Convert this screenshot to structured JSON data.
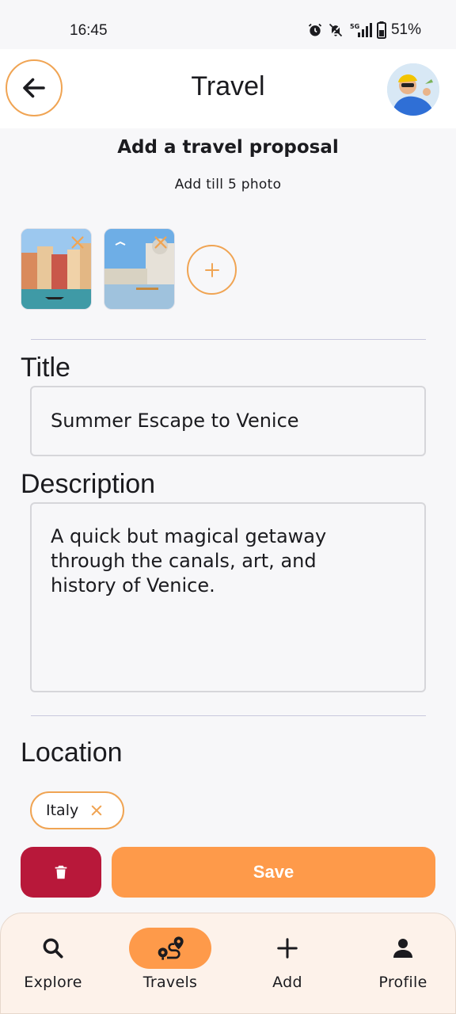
{
  "status_bar": {
    "time": "16:45",
    "battery": "51%",
    "icons": [
      "alarm-icon",
      "bell-off-icon",
      "signal-5g-icon",
      "battery-icon"
    ]
  },
  "header": {
    "title": "Travel",
    "back_icon": "arrow-left-icon"
  },
  "form": {
    "heading": "Add a travel proposal",
    "subheading": "Add till 5 photo",
    "photos": [
      {
        "name": "venice-canal-photo"
      },
      {
        "name": "venice-lagoon-photo"
      }
    ],
    "title_label": "Title",
    "title_value": "Summer Escape to Venice",
    "description_label": "Description",
    "description_value": "A quick but magical getaway\nthrough the canals, art, and\nhistory of Venice.",
    "location_label": "Location",
    "location_chip": "Italy"
  },
  "actions": {
    "save_label": "Save",
    "delete_icon": "trash-icon"
  },
  "bottom_nav": {
    "items": [
      {
        "label": "Explore",
        "icon": "search-icon",
        "active": false
      },
      {
        "label": "Travels",
        "icon": "route-icon",
        "active": true
      },
      {
        "label": "Add",
        "icon": "plus-icon",
        "active": false
      },
      {
        "label": "Profile",
        "icon": "person-icon",
        "active": false
      }
    ]
  },
  "colors": {
    "accent": "#fe9a4a",
    "accent_border": "#f0a453",
    "delete": "#b8183a",
    "background": "#f7f7f9",
    "nav_background": "#fdf2ea"
  }
}
